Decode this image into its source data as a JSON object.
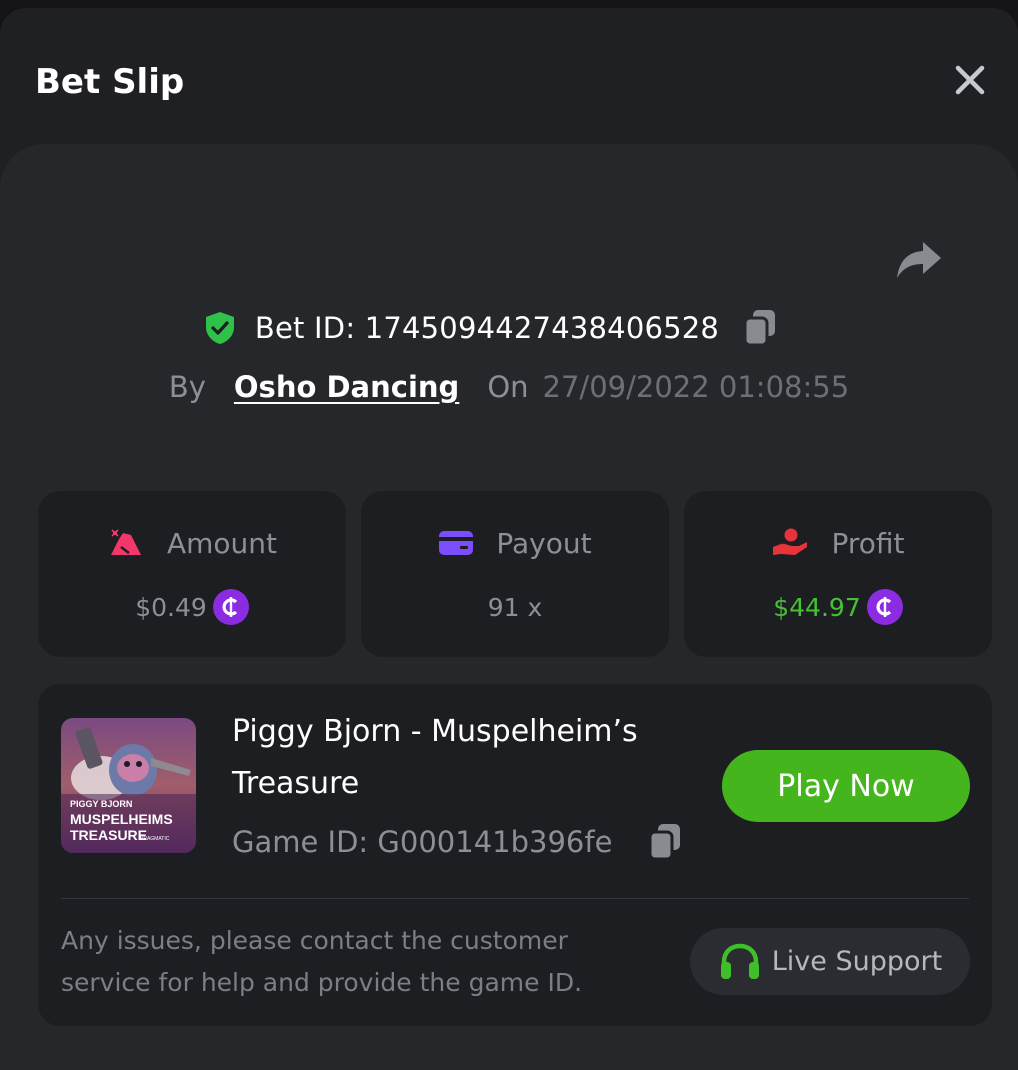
{
  "modal": {
    "title": "Bet Slip",
    "close_icon": "close-icon",
    "share_icon": "share-icon"
  },
  "bet": {
    "id_label": "Bet ID: 1745094427438406528",
    "by_label": "By",
    "user": "Osho Dancing",
    "on_label": "On",
    "datetime": "27/09/2022 01:08:55"
  },
  "stats": {
    "amount": {
      "label": "Amount",
      "value": "$0.49",
      "icon": "money-bag-icon"
    },
    "payout": {
      "label": "Payout",
      "value": "91 x",
      "icon": "card-icon"
    },
    "profit": {
      "label": "Profit",
      "value": "$44.97",
      "icon": "hand-coin-icon"
    }
  },
  "game": {
    "title": "Piggy Bjorn - Muspelheim’s Treasure",
    "id_label": "Game ID: G000141b396fe",
    "thumb_text_line1": "PIGGY BJORN",
    "thumb_text_line2": "MUSPELHEIMS",
    "thumb_text_line3": "TREASURE",
    "thumb_brand": "PRAGMATIC",
    "play_label": "Play Now"
  },
  "support": {
    "help_text": "Any issues, please contact the customer service for help and provide the game ID.",
    "button_label": "Live Support"
  },
  "colors": {
    "profit_green": "#45c132",
    "play_green": "#45b51d",
    "coin_purple": "#8b2be2",
    "payout_purple": "#7c4dff",
    "amount_pink": "#f2386b",
    "profit_red": "#e8333a",
    "shield_green": "#2fc14a"
  }
}
